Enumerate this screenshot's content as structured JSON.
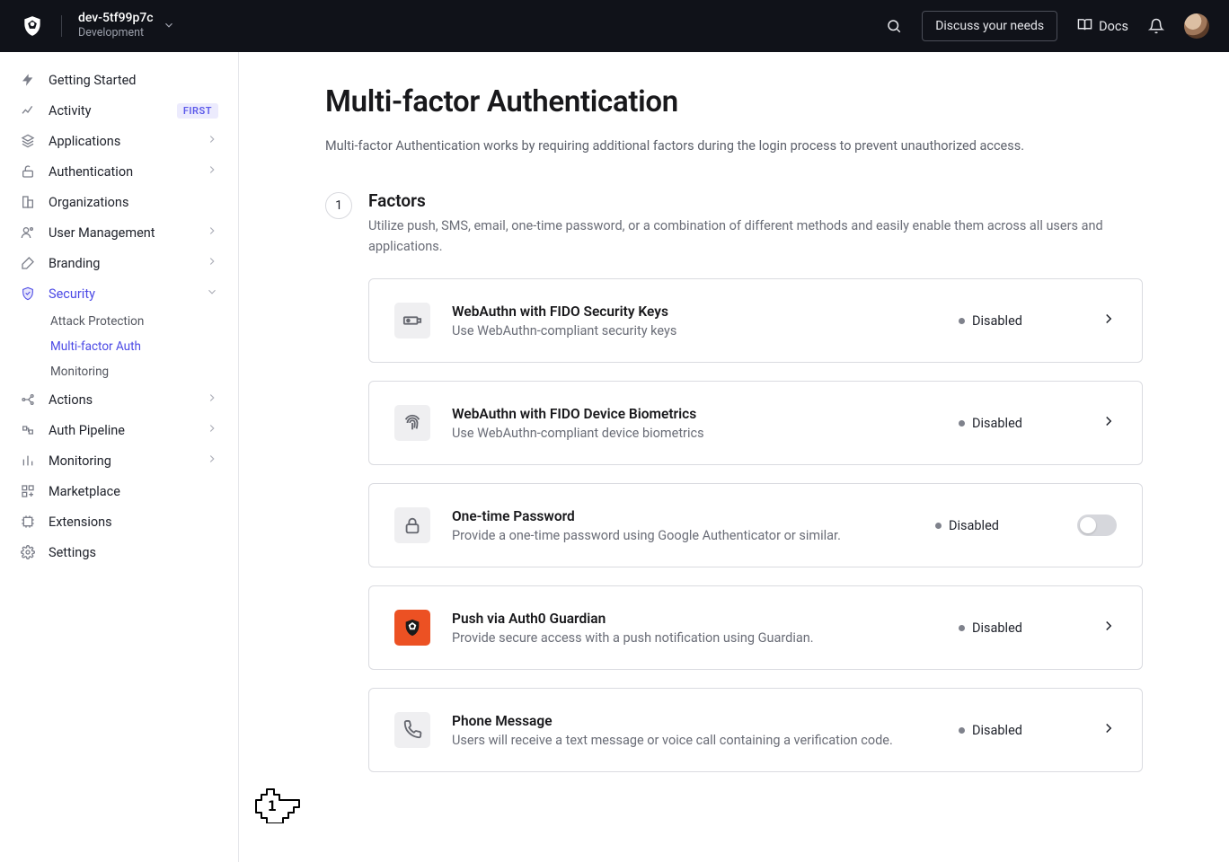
{
  "header": {
    "tenant_name": "dev-5tf99p7c",
    "tenant_env": "Development",
    "discuss_label": "Discuss your needs",
    "docs_label": "Docs"
  },
  "sidebar": {
    "items": [
      {
        "label": "Getting Started"
      },
      {
        "label": "Activity",
        "badge": "FIRST"
      },
      {
        "label": "Applications"
      },
      {
        "label": "Authentication"
      },
      {
        "label": "Organizations"
      },
      {
        "label": "User Management"
      },
      {
        "label": "Branding"
      },
      {
        "label": "Security"
      },
      {
        "label": "Actions"
      },
      {
        "label": "Auth Pipeline"
      },
      {
        "label": "Monitoring"
      },
      {
        "label": "Marketplace"
      },
      {
        "label": "Extensions"
      },
      {
        "label": "Settings"
      }
    ],
    "security_subitems": [
      {
        "label": "Attack Protection"
      },
      {
        "label": "Multi-factor Auth"
      },
      {
        "label": "Monitoring"
      }
    ]
  },
  "page": {
    "title": "Multi-factor Authentication",
    "lede": "Multi-factor Authentication works by requiring additional factors during the login process to prevent unauthorized access.",
    "section": {
      "step": "1",
      "title": "Factors",
      "desc": "Utilize push, SMS, email, one-time password, or a combination of different methods and easily enable them across all users and applications."
    },
    "factors": [
      {
        "title": "WebAuthn with FIDO Security Keys",
        "desc": "Use WebAuthn-compliant security keys",
        "status": "Disabled"
      },
      {
        "title": "WebAuthn with FIDO Device Biometrics",
        "desc": "Use WebAuthn-compliant device biometrics",
        "status": "Disabled"
      },
      {
        "title": "One-time Password",
        "desc": "Provide a one-time password using Google Authenticator or similar.",
        "status": "Disabled"
      },
      {
        "title": "Push via Auth0 Guardian",
        "desc": "Provide secure access with a push notification using Guardian.",
        "status": "Disabled"
      },
      {
        "title": "Phone Message",
        "desc": "Users will receive a text message or voice call containing a verification code.",
        "status": "Disabled"
      }
    ]
  }
}
